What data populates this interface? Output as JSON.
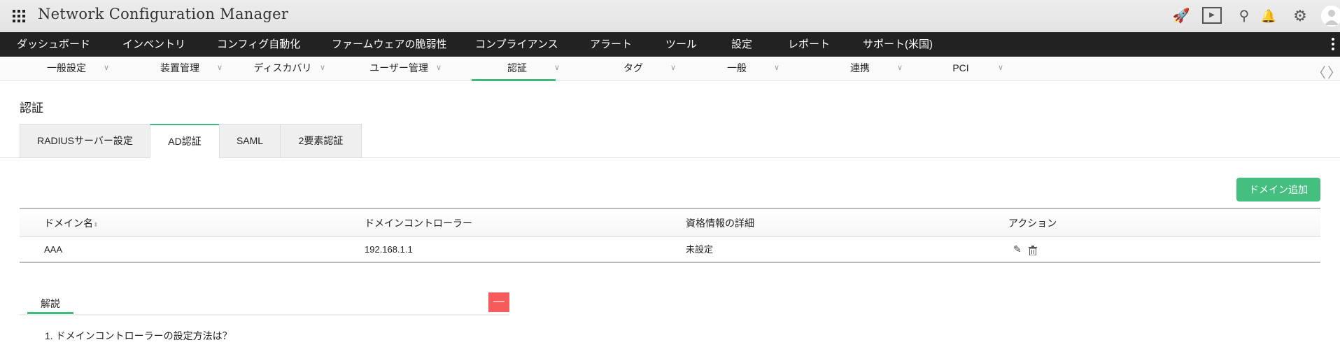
{
  "header": {
    "title": "Network Configuration Manager",
    "icons": [
      "rocket-icon",
      "presentation-icon",
      "search-icon",
      "bell-icon",
      "gear-icon",
      "user-avatar-icon"
    ]
  },
  "nav": {
    "items": [
      "ダッシュボード",
      "インベントリ",
      "コンフィグ自動化",
      "ファームウェアの脆弱性",
      "コンプライアンス",
      "アラート",
      "ツール",
      "設定",
      "レポート",
      "サポート(米国)"
    ]
  },
  "subnav": {
    "items": [
      "一般設定",
      "装置管理",
      "ディスカバリ",
      "ユーザー管理",
      "認証",
      "タグ",
      "一般",
      "連携",
      "PCI"
    ],
    "active": "認証"
  },
  "page": {
    "title": "認証"
  },
  "tabs": [
    "RADIUSサーバー設定",
    "AD認証",
    "SAML",
    "2要素認証"
  ],
  "active_tab": "AD認証",
  "add_button": "ドメイン追加",
  "table": {
    "headers": [
      "ドメイン名",
      "ドメインコントローラー",
      "資格情報の詳細",
      "アクション"
    ],
    "rows": [
      {
        "domain": "AAA",
        "controller": "192.168.1.1",
        "credentials": "未設定"
      }
    ]
  },
  "help": {
    "tab": "解説",
    "questions": [
      "1. ドメインコントローラーの設定方法は？"
    ]
  },
  "colors": {
    "accent": "#41b87a",
    "button": "#45bf7f",
    "collapse": "#f55b5b",
    "nav": "#222222"
  }
}
